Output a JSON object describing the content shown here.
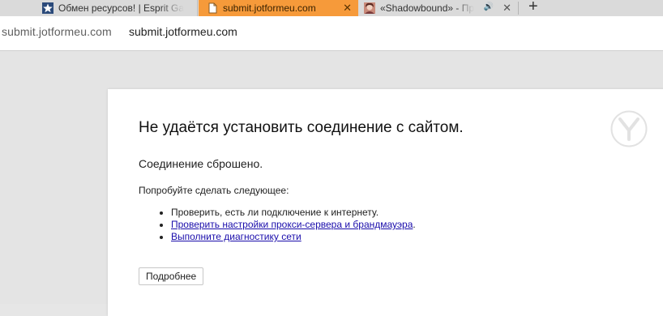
{
  "tabs": [
    {
      "title": "Обмен ресурсов! | Esprit Ga",
      "favicon": "star-favicon-icon",
      "active": false
    },
    {
      "title": "submit.jotformeu.com",
      "favicon": "blank-page-icon",
      "active": true,
      "close": "✕"
    },
    {
      "title": "«Shadowbound» - Пр",
      "favicon": "portrait-favicon-icon",
      "active": false,
      "audio": "🔊",
      "close": "✕"
    }
  ],
  "new_tab_label": "+",
  "address": {
    "host": "submit.jotformeu.com",
    "url": "submit.jotformeu.com"
  },
  "error": {
    "title": "Не удаётся установить соединение с сайтом.",
    "subtitle": "Соединение сброшено.",
    "try_text": "Попробуйте сделать следующее:",
    "suggestions": {
      "check_connection": "Проверить, есть ли подключение к интернету.",
      "check_proxy": "Проверить настройки прокси-сервера и брандмауэра",
      "check_proxy_suffix": ".",
      "diagnostics": "Выполните диагностику сети"
    },
    "details_button": "Подробнее",
    "logo_icon": "yandex-browser-logo-icon"
  },
  "colors": {
    "active_tab": "#f69a3a",
    "link": "#1a0dab",
    "page_background": "#e4e4e4"
  }
}
